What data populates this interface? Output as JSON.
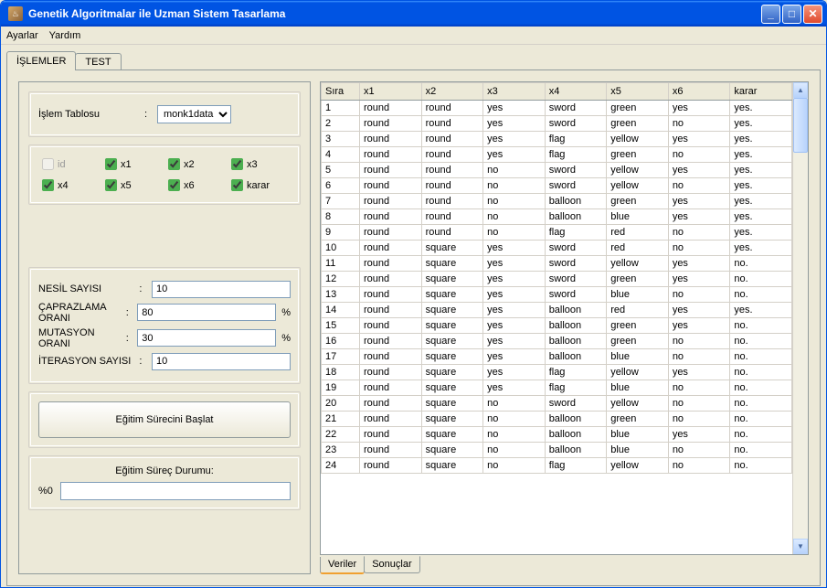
{
  "window": {
    "title": "Genetik Algoritmalar ile Uzman Sistem Tasarlama"
  },
  "menu": {
    "ayarlar": "Ayarlar",
    "yardim": "Yardım"
  },
  "tabs": {
    "islemler": "İŞLEMLER",
    "test": "TEST"
  },
  "left": {
    "islemTablosu": "İşlem Tablosu",
    "islemTablosuValue": "monk1data",
    "cb": {
      "id": "id",
      "x1": "x1",
      "x2": "x2",
      "x3": "x3",
      "x4": "x4",
      "x5": "x5",
      "x6": "x6",
      "karar": "karar"
    },
    "nesil": "NESİL SAYISI",
    "nesilVal": "10",
    "capraz": "ÇAPRAZLAMA ORANI",
    "caprazVal": "80",
    "pct": "%",
    "mutasyon": "MUTASYON ORANI",
    "mutasyonVal": "30",
    "iterasyon": "İTERASYON SAYISI",
    "iterasyonVal": "10",
    "egitimBtn": "Eğitim Sürecini Başlat",
    "durumLabel": "Eğitim Süreç Durumu:",
    "durumPct": "%0",
    "durumVal": ""
  },
  "table": {
    "headers": [
      "Sıra",
      "x1",
      "x2",
      "x3",
      "x4",
      "x5",
      "x6",
      "karar"
    ],
    "rows": [
      [
        "1",
        "round",
        "round",
        "yes",
        "sword",
        "green",
        "yes",
        "yes."
      ],
      [
        "2",
        "round",
        "round",
        "yes",
        "sword",
        "green",
        "no",
        "yes."
      ],
      [
        "3",
        "round",
        "round",
        "yes",
        "flag",
        "yellow",
        "yes",
        "yes."
      ],
      [
        "4",
        "round",
        "round",
        "yes",
        "flag",
        "green",
        "no",
        "yes."
      ],
      [
        "5",
        "round",
        "round",
        "no",
        "sword",
        "yellow",
        "yes",
        "yes."
      ],
      [
        "6",
        "round",
        "round",
        "no",
        "sword",
        "yellow",
        "no",
        "yes."
      ],
      [
        "7",
        "round",
        "round",
        "no",
        "balloon",
        "green",
        "yes",
        "yes."
      ],
      [
        "8",
        "round",
        "round",
        "no",
        "balloon",
        "blue",
        "yes",
        "yes."
      ],
      [
        "9",
        "round",
        "round",
        "no",
        "flag",
        "red",
        "no",
        "yes."
      ],
      [
        "10",
        "round",
        "square",
        "yes",
        "sword",
        "red",
        "no",
        "yes."
      ],
      [
        "11",
        "round",
        "square",
        "yes",
        "sword",
        "yellow",
        "yes",
        "no."
      ],
      [
        "12",
        "round",
        "square",
        "yes",
        "sword",
        "green",
        "yes",
        "no."
      ],
      [
        "13",
        "round",
        "square",
        "yes",
        "sword",
        "blue",
        "no",
        "no."
      ],
      [
        "14",
        "round",
        "square",
        "yes",
        "balloon",
        "red",
        "yes",
        "yes."
      ],
      [
        "15",
        "round",
        "square",
        "yes",
        "balloon",
        "green",
        "yes",
        "no."
      ],
      [
        "16",
        "round",
        "square",
        "yes",
        "balloon",
        "green",
        "no",
        "no."
      ],
      [
        "17",
        "round",
        "square",
        "yes",
        "balloon",
        "blue",
        "no",
        "no."
      ],
      [
        "18",
        "round",
        "square",
        "yes",
        "flag",
        "yellow",
        "yes",
        "no."
      ],
      [
        "19",
        "round",
        "square",
        "yes",
        "flag",
        "blue",
        "no",
        "no."
      ],
      [
        "20",
        "round",
        "square",
        "no",
        "sword",
        "yellow",
        "no",
        "no."
      ],
      [
        "21",
        "round",
        "square",
        "no",
        "balloon",
        "green",
        "no",
        "no."
      ],
      [
        "22",
        "round",
        "square",
        "no",
        "balloon",
        "blue",
        "yes",
        "no."
      ],
      [
        "23",
        "round",
        "square",
        "no",
        "balloon",
        "blue",
        "no",
        "no."
      ],
      [
        "24",
        "round",
        "square",
        "no",
        "flag",
        "yellow",
        "no",
        "no."
      ]
    ]
  },
  "bottomTabs": {
    "veriler": "Veriler",
    "sonuclar": "Sonuçlar"
  }
}
